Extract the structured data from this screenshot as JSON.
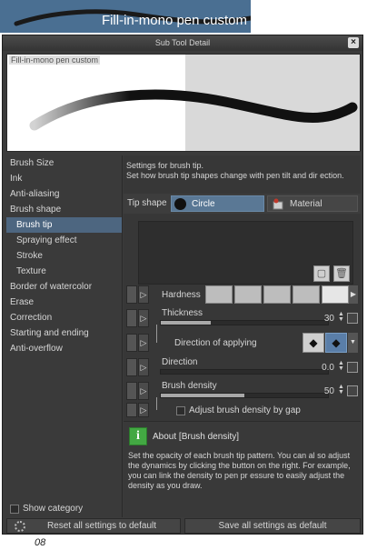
{
  "banner": {
    "title": "Fill-in-mono pen custom"
  },
  "window": {
    "title": "Sub Tool Detail",
    "close_label": "×"
  },
  "preview": {
    "label": "Fill-in-mono pen custom"
  },
  "sidebar": {
    "items": [
      {
        "label": "Brush Size",
        "selected": false,
        "sub": false
      },
      {
        "label": "Ink",
        "selected": false,
        "sub": false
      },
      {
        "label": "Anti-aliasing",
        "selected": false,
        "sub": false
      },
      {
        "label": "Brush shape",
        "selected": false,
        "sub": false
      },
      {
        "label": "Brush tip",
        "selected": true,
        "sub": true
      },
      {
        "label": "Spraying effect",
        "selected": false,
        "sub": true
      },
      {
        "label": "Stroke",
        "selected": false,
        "sub": true
      },
      {
        "label": "Texture",
        "selected": false,
        "sub": true
      },
      {
        "label": "Border of watercolor",
        "selected": false,
        "sub": false
      },
      {
        "label": "Erase",
        "selected": false,
        "sub": false
      },
      {
        "label": "Correction",
        "selected": false,
        "sub": false
      },
      {
        "label": "Starting and ending",
        "selected": false,
        "sub": false
      },
      {
        "label": "Anti-overflow",
        "selected": false,
        "sub": false
      }
    ],
    "show_category": "Show category"
  },
  "content": {
    "description": "Settings for brush tip.\nSet how brush tip shapes change with pen tilt and dir ection.",
    "tip_shape": {
      "label": "Tip shape",
      "circle_label": "Circle",
      "material_label": "Material"
    },
    "params": {
      "hardness": {
        "label": "Hardness"
      },
      "thickness": {
        "label": "Thickness",
        "value": "30",
        "fraction": 0.3
      },
      "direction_of_applying": {
        "label": "Direction of applying"
      },
      "direction": {
        "label": "Direction",
        "value": "0.0",
        "fraction": 0.0
      },
      "brush_density": {
        "label": "Brush density",
        "value": "50",
        "fraction": 0.5
      },
      "adjust_density": {
        "label": "Adjust brush density by gap"
      }
    },
    "about": {
      "title": "About [Brush density]",
      "text": "Set the opacity of each brush tip pattern. You can al so adjust the dynamics by clicking the button on the right. For example, you can link the density to pen pr essure to easily adjust the density as you draw."
    }
  },
  "footer": {
    "reset_label": "Reset all settings to default",
    "save_label": "Save all settings as default"
  },
  "page_number": "08",
  "colors": {
    "banner": "#4a6f92",
    "selected": "#4d6680",
    "info_icon": "#43a843"
  }
}
